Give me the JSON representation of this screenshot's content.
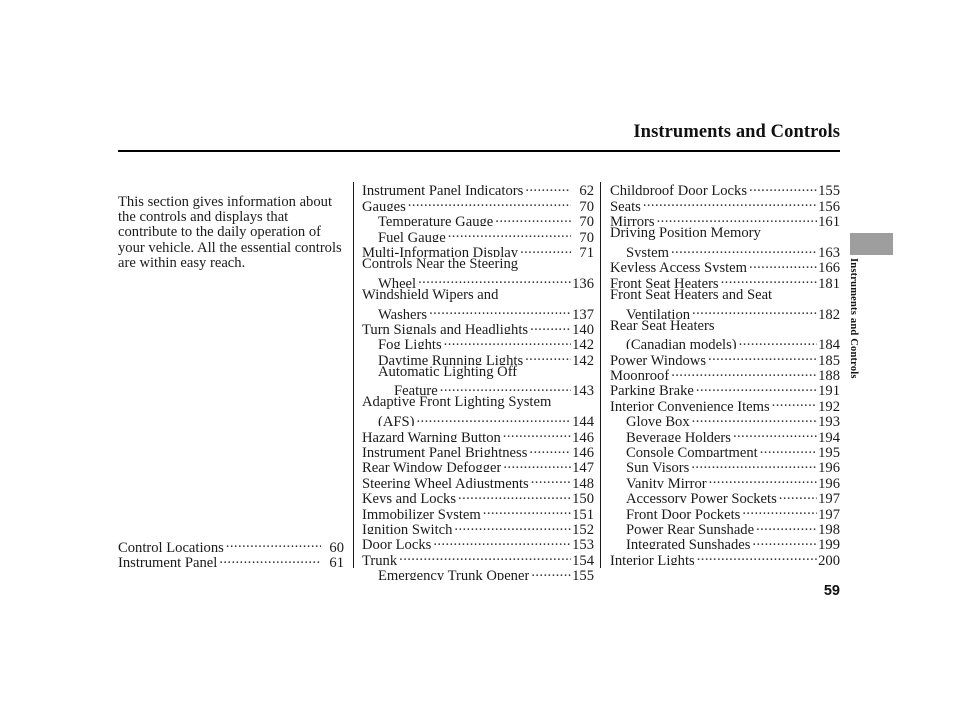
{
  "header": {
    "title": "Instruments and Controls"
  },
  "side_tab": {
    "label": "Instruments and Controls",
    "block_color": "#9e9e9e"
  },
  "footer": {
    "page_number": "59"
  },
  "left_column": {
    "intro": "This section gives information about the controls and displays that contribute to the daily operation of your vehicle. All the essential controls are within easy reach.",
    "entries": [
      {
        "label": "Control Locations",
        "page": "60",
        "indent": 0
      },
      {
        "label": "Instrument Panel",
        "page": "61",
        "indent": 0
      }
    ]
  },
  "middle_column": {
    "entries": [
      {
        "label": "Instrument Panel Indicators",
        "page": "62",
        "indent": 0
      },
      {
        "label": "Gauges",
        "page": "70",
        "indent": 0
      },
      {
        "label": "Temperature Gauge",
        "page": "70",
        "indent": 1
      },
      {
        "label": "Fuel Gauge",
        "page": "70",
        "indent": 1
      },
      {
        "label": "Multi-Information Display",
        "page": "71",
        "indent": 0
      },
      {
        "label": "Controls Near the Steering",
        "page": "",
        "indent": 0,
        "nodots": true
      },
      {
        "label": "Wheel",
        "page": "136",
        "indent": 1
      },
      {
        "label": "Windshield Wipers and",
        "page": "",
        "indent": 0,
        "nodots": true
      },
      {
        "label": "Washers",
        "page": "137",
        "indent": 1
      },
      {
        "label": "Turn Signals and Headlights",
        "page": "140",
        "indent": 0
      },
      {
        "label": "Fog Lights",
        "page": "142",
        "indent": 1
      },
      {
        "label": "Daytime Running Lights",
        "page": "142",
        "indent": 1
      },
      {
        "label": "Automatic Lighting Off",
        "page": "",
        "indent": 1,
        "nodots": true
      },
      {
        "label": "Feature",
        "page": "143",
        "indent": 2
      },
      {
        "label": "Adaptive Front Lighting System",
        "page": "",
        "indent": 0,
        "nodots": true
      },
      {
        "label": "(AFS)",
        "page": "144",
        "indent": 1
      },
      {
        "label": "Hazard Warning Button",
        "page": "146",
        "indent": 0
      },
      {
        "label": "Instrument Panel Brightness",
        "page": "146",
        "indent": 0
      },
      {
        "label": "Rear Window Defogger",
        "page": "147",
        "indent": 0
      },
      {
        "label": "Steering Wheel Adjustments",
        "page": "148",
        "indent": 0
      },
      {
        "label": "Keys and Locks",
        "page": "150",
        "indent": 0
      },
      {
        "label": "Immobilizer System",
        "page": "151",
        "indent": 0
      },
      {
        "label": "Ignition Switch",
        "page": "152",
        "indent": 0
      },
      {
        "label": "Door Locks",
        "page": "153",
        "indent": 0
      },
      {
        "label": "Trunk",
        "page": "154",
        "indent": 0
      },
      {
        "label": "Emergency Trunk Opener",
        "page": "155",
        "indent": 1
      }
    ]
  },
  "right_column": {
    "entries": [
      {
        "label": "Childproof Door Locks",
        "page": "155",
        "indent": 0
      },
      {
        "label": "Seats",
        "page": "156",
        "indent": 0
      },
      {
        "label": "Mirrors",
        "page": "161",
        "indent": 0
      },
      {
        "label": "Driving Position Memory",
        "page": "",
        "indent": 0,
        "nodots": true
      },
      {
        "label": "System",
        "page": "163",
        "indent": 1
      },
      {
        "label": "Keyless Access System",
        "page": "166",
        "indent": 0
      },
      {
        "label": "Front Seat Heaters",
        "page": "181",
        "indent": 0
      },
      {
        "label": "Front Seat Heaters and Seat",
        "page": "",
        "indent": 0,
        "nodots": true
      },
      {
        "label": "Ventilation",
        "page": "182",
        "indent": 1
      },
      {
        "label": "Rear Seat Heaters",
        "page": "",
        "indent": 0,
        "nodots": true
      },
      {
        "label": "(Canadian models)",
        "page": "184",
        "indent": 1
      },
      {
        "label": "Power Windows",
        "page": "185",
        "indent": 0
      },
      {
        "label": "Moonroof",
        "page": "188",
        "indent": 0
      },
      {
        "label": "Parking Brake",
        "page": "191",
        "indent": 0
      },
      {
        "label": "Interior Convenience Items",
        "page": "192",
        "indent": 0
      },
      {
        "label": "Glove Box",
        "page": "193",
        "indent": 1
      },
      {
        "label": "Beverage Holders",
        "page": "194",
        "indent": 1
      },
      {
        "label": "Console Compartment",
        "page": "195",
        "indent": 1
      },
      {
        "label": "Sun Visors",
        "page": "196",
        "indent": 1
      },
      {
        "label": "Vanity Mirror",
        "page": "196",
        "indent": 1
      },
      {
        "label": "Accessory Power Sockets",
        "page": "197",
        "indent": 1
      },
      {
        "label": "Front Door Pockets",
        "page": "197",
        "indent": 1
      },
      {
        "label": "Power Rear Sunshade",
        "page": "198",
        "indent": 1
      },
      {
        "label": "Integrated Sunshades",
        "page": "199",
        "indent": 1
      },
      {
        "label": "Interior Lights",
        "page": "200",
        "indent": 0
      }
    ]
  }
}
